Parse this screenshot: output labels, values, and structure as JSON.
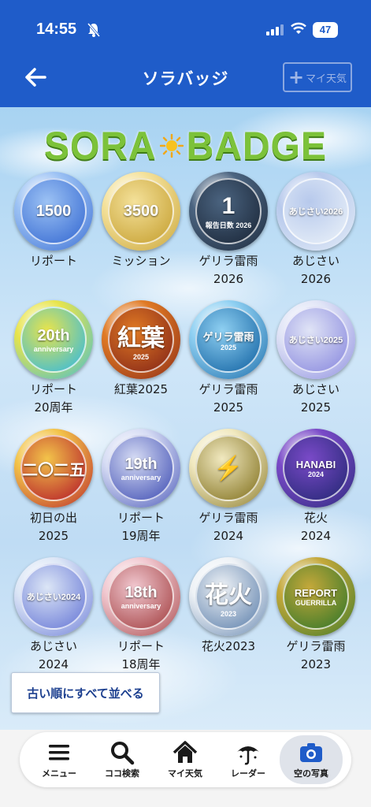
{
  "status_bar": {
    "time": "14:55",
    "battery": "47"
  },
  "nav": {
    "title": "ソラバッジ",
    "my_weather_label": "マイ天気",
    "my_weather_plus": "+"
  },
  "logo": {
    "left": "SORA",
    "right": "BADGE"
  },
  "badges": [
    {
      "label": "リポート",
      "face": "1500",
      "colors": [
        "#3c6fd4",
        "#9cc2f4"
      ]
    },
    {
      "label": "ミッション",
      "face": "3500",
      "colors": [
        "#c9a437",
        "#f4e19a"
      ]
    },
    {
      "label": "ゲリラ雷雨\n2026",
      "face": "1",
      "sub": "報告日数 2026",
      "colors": [
        "#1d2a3c",
        "#4b6480"
      ]
    },
    {
      "label": "あじさい\n2026",
      "face": "あじさい2026",
      "colors": [
        "#e6eef8",
        "#b7c9ec"
      ]
    },
    {
      "label": "リポート\n20周年",
      "face": "20th",
      "sub": "anniversary",
      "colors": [
        "#3bbbd9",
        "#e8e44c"
      ]
    },
    {
      "label": "紅葉2025",
      "face": "紅葉",
      "sub": "2025",
      "colors": [
        "#8a2a18",
        "#e07a24"
      ]
    },
    {
      "label": "ゲリラ雷雨\n2025",
      "face": "ゲリラ雷雨",
      "sub": "2025",
      "colors": [
        "#1a6aa8",
        "#8fd0f2"
      ]
    },
    {
      "label": "あじさい\n2025",
      "face": "あじさい2025",
      "colors": [
        "#8f8fe0",
        "#e0e4f6"
      ]
    },
    {
      "label": "初日の出\n2025",
      "face": "二〇二五",
      "colors": [
        "#b8242a",
        "#f3c44a"
      ]
    },
    {
      "label": "リポート\n19周年",
      "face": "19th",
      "sub": "anniversary",
      "colors": [
        "#4a58b8",
        "#d6dcf4"
      ]
    },
    {
      "label": "ゲリラ雷雨\n2024",
      "face": "⚡",
      "colors": [
        "#8a7a2a",
        "#f1e9c0"
      ]
    },
    {
      "label": "花火\n2024",
      "face": "HANABI",
      "sub": "2024",
      "colors": [
        "#2a2a7a",
        "#7a4ac8"
      ]
    },
    {
      "label": "あじさい\n2024",
      "face": "あじさい2024",
      "colors": [
        "#6f7fd8",
        "#dce6f6"
      ]
    },
    {
      "label": "リポート\n18周年",
      "face": "18th",
      "sub": "anniversary",
      "colors": [
        "#a8484a",
        "#f1c8d0"
      ]
    },
    {
      "label": "花火2023",
      "face": "花火",
      "sub": "2023",
      "colors": [
        "#6a8ab2",
        "#eef2f6"
      ]
    },
    {
      "label": "ゲリラ雷雨\n2023",
      "face": "REPORT",
      "sub": "GUERRILLA",
      "colors": [
        "#3c7a2a",
        "#c4a83a"
      ]
    }
  ],
  "sort_button": "古い順にすべて並べる",
  "tabs": [
    {
      "label": "メニュー",
      "icon": "menu-icon"
    },
    {
      "label": "ココ検索",
      "icon": "search-icon"
    },
    {
      "label": "マイ天気",
      "icon": "home-icon"
    },
    {
      "label": "レーダー",
      "icon": "umbrella-icon"
    },
    {
      "label": "空の写真",
      "icon": "camera-icon",
      "active": true
    }
  ]
}
